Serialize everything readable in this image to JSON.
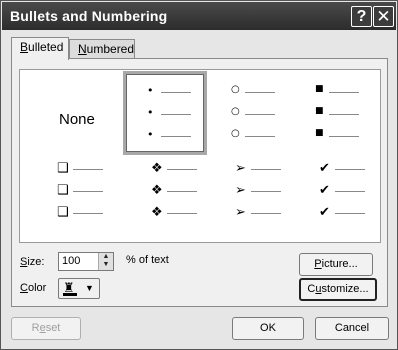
{
  "window": {
    "title": "Bullets and Numbering",
    "help_symbol": "?",
    "close_symbol": "✕"
  },
  "tabs": [
    {
      "label": "Bulleted",
      "mnemonic": "B",
      "rest": "ulleted",
      "active": true
    },
    {
      "label": "Numbered",
      "mnemonic": "N",
      "rest": "umbered",
      "active": false
    }
  ],
  "bullet_grid": {
    "none_label": "None",
    "selected_index": 1,
    "styles": [
      {
        "name": "none"
      },
      {
        "name": "small-dot",
        "glyph": "•"
      },
      {
        "name": "hollow-circle",
        "glyph": "○"
      },
      {
        "name": "filled-square",
        "glyph": "■"
      },
      {
        "name": "hollow-square",
        "glyph": "❑"
      },
      {
        "name": "four-diamonds",
        "glyph": "❖"
      },
      {
        "name": "arrowhead",
        "glyph": "➢"
      },
      {
        "name": "checkmark",
        "glyph": "✔"
      }
    ]
  },
  "size": {
    "label_mnemonic": "S",
    "label_rest": "ize:",
    "value": "100",
    "suffix": "% of text",
    "spinner_up": "▲",
    "spinner_down": "▼"
  },
  "color": {
    "label_mnemonic": "C",
    "label_rest": "olor",
    "bucket_icon": "fill-bucket-icon",
    "arrow": "▼",
    "current_color": "#000000"
  },
  "buttons": {
    "picture_mnemonic": "P",
    "picture_rest": "icture...",
    "customize_mnemonic": "u",
    "customize_pre": "C",
    "customize_rest": "stomize...",
    "reset": "Reset",
    "reset_mnemonic": "e",
    "ok": "OK",
    "cancel": "Cancel"
  }
}
